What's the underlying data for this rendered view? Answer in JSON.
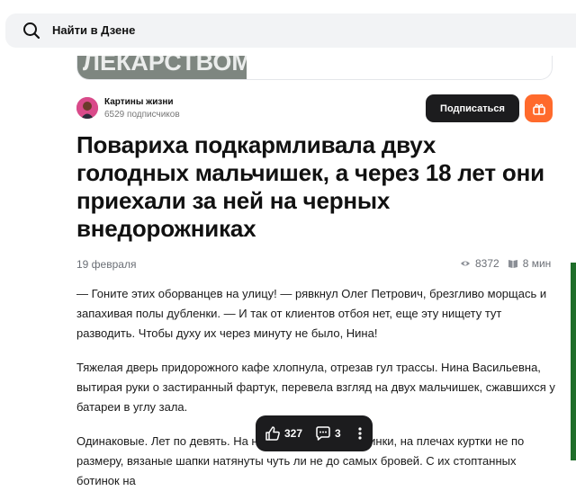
{
  "search": {
    "label": "Найти в Дзене"
  },
  "ad": {
    "text": "ЛЕКАРСТВОМ"
  },
  "channel": {
    "name": "Картины жизни",
    "subscribers": "6529 подписчиков",
    "subscribe_label": "Подписаться"
  },
  "article": {
    "title": "Повариха подкармливала двух голодных мальчишек, а через 18 лет они приехали за ней на черных внедорожниках",
    "date": "19 февраля",
    "views": "8372",
    "read_time": "8 мин",
    "paragraphs": [
      "— Гоните этих оборванцев на улицу! — рявкнул Олег Петрович, брезгливо морщась и запахивая полы дубленки. — И так от клиентов отбоя нет, еще эту нищету тут разводить. Чтобы духу их через минуту не было, Нина!",
      "Тяжелая дверь придорожного кафе хлопнула, отрезав гул трассы. Нина Васильевна, вытирая руки о застиранный фартук, перевела взгляд на двух мальчишек, сжавшихся у батареи в углу зала.",
      "Одинаковые. Лет по девять. На ногах стоптанные ботинки, на плечах куртки не по размеру, вязаные шапки натянуты чуть ли не до самых бровей. С их стоптанных ботинок на"
    ]
  },
  "reactions": {
    "likes": "327",
    "comments": "3"
  },
  "colors": {
    "accent": "#ff6a2c",
    "dark": "#1c1c1e"
  }
}
